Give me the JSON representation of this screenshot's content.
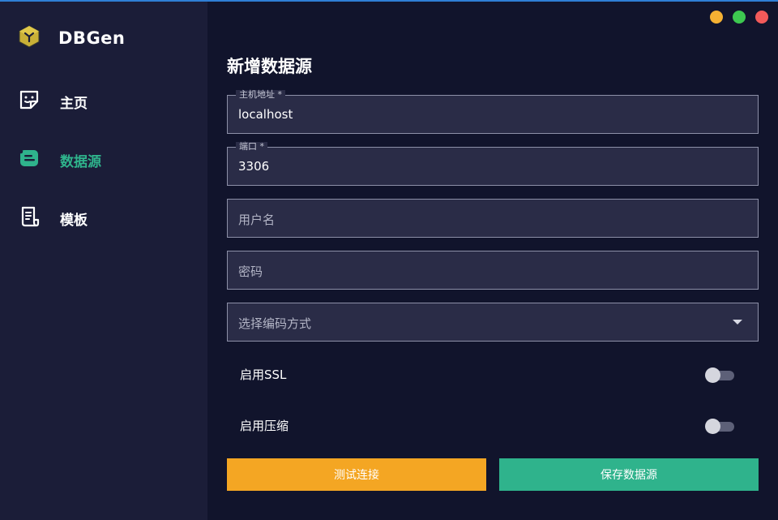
{
  "app": {
    "name": "DBGen"
  },
  "colors": {
    "accent": "#2fb38c",
    "sidebar_bg": "#1b1d38",
    "main_bg": "#11142c",
    "test_button": "#f4a623",
    "save_button": "#2fb38c",
    "window_minimize": "#f5b133",
    "window_maximize": "#3dc850",
    "window_close": "#f25a5a"
  },
  "sidebar": {
    "items": [
      {
        "label": "主页",
        "icon": "sticker-smile-icon",
        "active": false
      },
      {
        "label": "数据源",
        "icon": "data-card-icon",
        "active": true
      },
      {
        "label": "模板",
        "icon": "document-template-icon",
        "active": false
      }
    ]
  },
  "window": {
    "controls": [
      "minimize",
      "maximize",
      "close"
    ]
  },
  "form": {
    "title": "新增数据源",
    "host": {
      "label": "主机地址 *",
      "value": "localhost"
    },
    "port": {
      "label": "端口 *",
      "value": "3306"
    },
    "username": {
      "placeholder": "用户名"
    },
    "password": {
      "placeholder": "密码"
    },
    "encoding": {
      "placeholder": "选择编码方式"
    },
    "ssl": {
      "label": "启用SSL",
      "enabled": false
    },
    "compression": {
      "label": "启用压缩",
      "enabled": false
    }
  },
  "actions": {
    "test_label": "测试连接",
    "save_label": "保存数据源"
  }
}
